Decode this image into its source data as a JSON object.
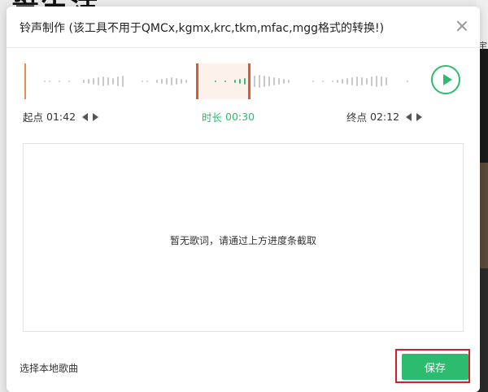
{
  "background": {
    "title_fragment": "誓生活",
    "right_char": "宇"
  },
  "dialog": {
    "title": "铃声制作 (该工具不用于QMCx,kgmx,krc,tkm,mfac,mgg格式的转换!)",
    "close_icon": "close-icon"
  },
  "waveform": {
    "selection_color": "#35c07a",
    "handle_color": "#e2552f",
    "play_icon": "play-icon"
  },
  "times": {
    "start_label": "起点",
    "start_value": "01:42",
    "duration_label": "时长",
    "duration_value": "00:30",
    "end_label": "终点",
    "end_value": "02:12"
  },
  "lyrics": {
    "empty_text": "暂无歌词，请通过上方进度条截取"
  },
  "footer": {
    "local_song_label": "选择本地歌曲",
    "save_label": "保存",
    "accent": "#2dbb6f",
    "highlight": "#d81e2a"
  }
}
